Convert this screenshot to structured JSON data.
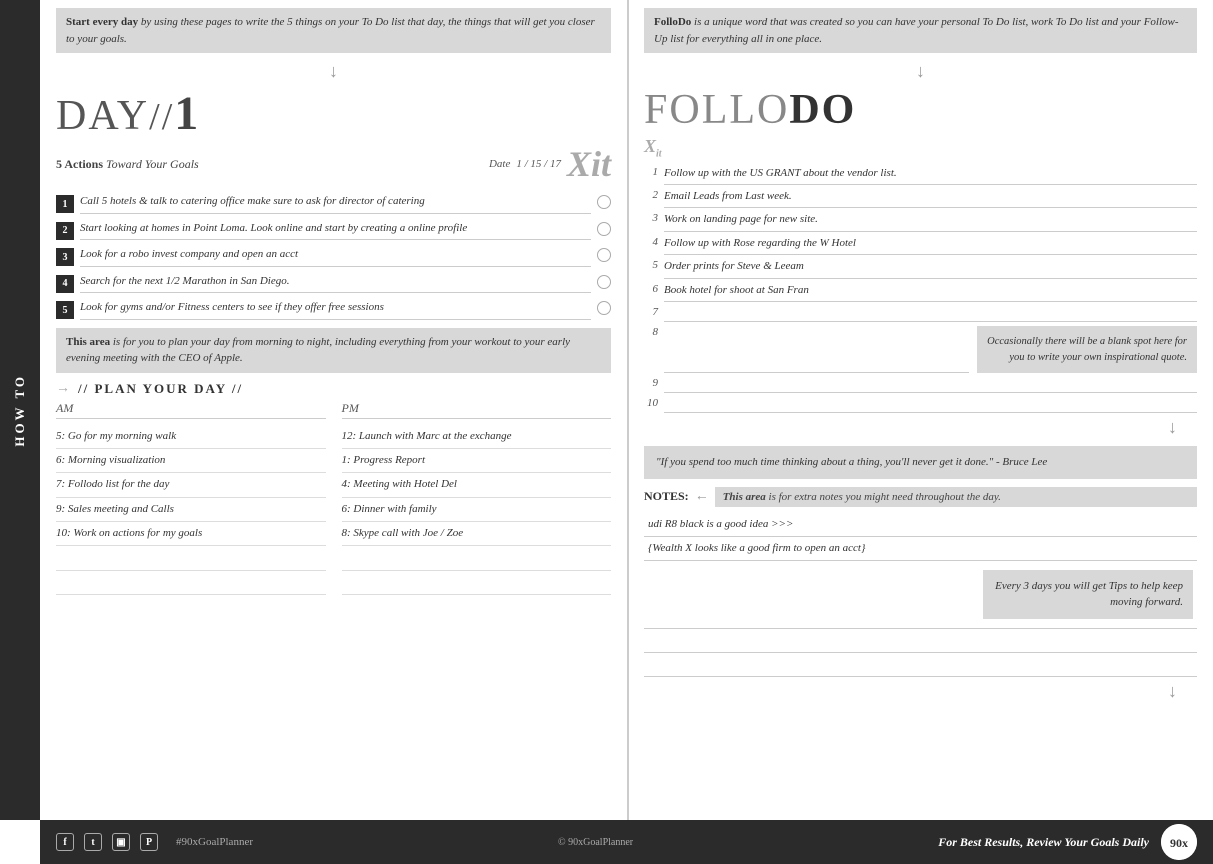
{
  "sidebar": {
    "label": "HOW TO"
  },
  "left": {
    "intro": {
      "bold": "Start every day",
      "rest": " by using these pages to write the 5 things on your To Do list that day, the things that will get you closer to your goals."
    },
    "day_heading": "DAY",
    "day_slash": "//",
    "day_number": "1",
    "five_actions_bold": "5 Actions",
    "five_actions_rest": " Toward Your Goals",
    "date_label": "Date",
    "date_value": "1 / 15 / 17",
    "xit_label": "Xit",
    "actions": [
      {
        "num": "1",
        "text": "Call 5 hotels & talk to catering office make sure to ask for director of catering"
      },
      {
        "num": "2",
        "text": "Start looking at homes in Point Loma. Look online and start by creating a online profile"
      },
      {
        "num": "3",
        "text": "Look for a robo invest company and open an acct"
      },
      {
        "num": "4",
        "text": "Search for the next 1/2 Marathon in San Diego."
      },
      {
        "num": "5",
        "text": "Look for gyms and/or Fitness centers to see if they offer free sessions"
      }
    ],
    "plan_intro_bold": "This area",
    "plan_intro_rest": " is for you to plan your day from morning to night, including everything from your workout to your early evening meeting with the CEO of Apple.",
    "plan_heading": "// PLAN YOUR DAY //",
    "am_label": "AM",
    "pm_label": "PM",
    "am_items": [
      "5: Go for my morning walk",
      "6: Morning visualization",
      "7: Follodo list for the day",
      "9: Sales meeting and Calls",
      "10: Work on actions for my goals"
    ],
    "pm_items": [
      "12: Launch with Marc at the exchange",
      "1: Progress Report",
      "4: Meeting with Hotel Del",
      "6: Dinner with family",
      "8: Skype call with Joe / Zoe"
    ]
  },
  "right": {
    "intro_bold": "FolloDo",
    "intro_rest": " is a unique word that was created so you can have your personal To Do list, work To Do list and your Follow-Up list for everything all in one place.",
    "follo_heading_light": "FOLLO",
    "follo_heading_bold": "DO",
    "follo_items": [
      {
        "num": "1",
        "text": "Follow up with the US GRANT about the vendor list."
      },
      {
        "num": "2",
        "text": "Email Leads from Last week."
      },
      {
        "num": "3",
        "text": "Work on landing page for new site."
      },
      {
        "num": "4",
        "text": "Follow up with Rose regarding the W Hotel"
      },
      {
        "num": "5",
        "text": "Order prints for Steve & Leeam"
      },
      {
        "num": "6",
        "text": "Book hotel for shoot at San Fran"
      },
      {
        "num": "7",
        "text": ""
      },
      {
        "num": "8",
        "text": ""
      },
      {
        "num": "9",
        "text": ""
      },
      {
        "num": "10",
        "text": ""
      }
    ],
    "callout": "Occasionally there will be a blank spot here for you to write your own inspirational quote.",
    "quote": "\"If you spend too much time thinking about a thing, you'll never get it done.\" - Bruce Lee",
    "notes_label": "NOTES:",
    "notes_desc": "This area is for extra notes you might need throughout the day.",
    "notes_items": [
      "udi R8 black is a good idea >>>",
      "{Wealth X looks like a good firm to open an acct}",
      "",
      "",
      ""
    ],
    "tips_callout": "Every 3 days you will get Tips to help keep moving forward."
  },
  "footer": {
    "hashtag": "#90xGoalPlanner",
    "copyright": "© 90xGoalPlanner",
    "tagline": "For Best Results, Review Your Goals Daily",
    "logo": "90x"
  }
}
